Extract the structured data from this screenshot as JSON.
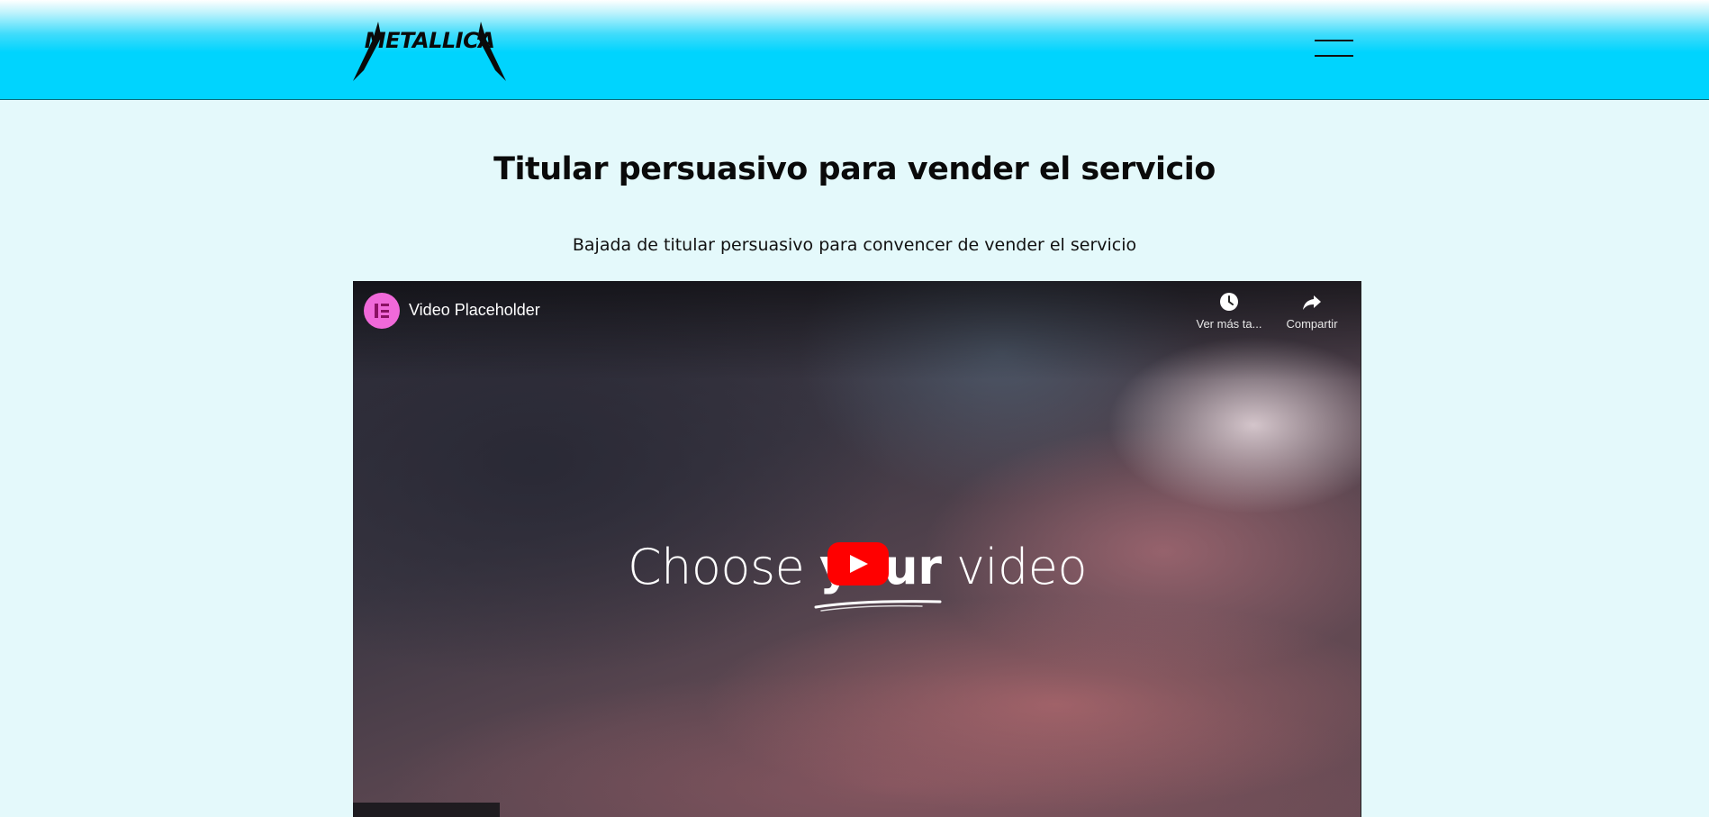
{
  "header": {
    "logo_text": "METALLICA",
    "menu_icon": "hamburger-menu-icon",
    "bar_color": "#00d4fe"
  },
  "main": {
    "headline": "Titular persuasivo para vender el servicio",
    "subheadline": "Bajada de titular persuasivo para convencer de vender el servicio"
  },
  "video": {
    "channel_icon": "elementor-icon",
    "title": "Video Placeholder",
    "watch_later_label": "Ver más ta...",
    "share_label": "Compartir",
    "overlay_text_before": "Choose ",
    "overlay_text_bold": "your",
    "overlay_text_after": " video",
    "play_icon": "youtube-play-icon",
    "accent": "#ff0000"
  }
}
